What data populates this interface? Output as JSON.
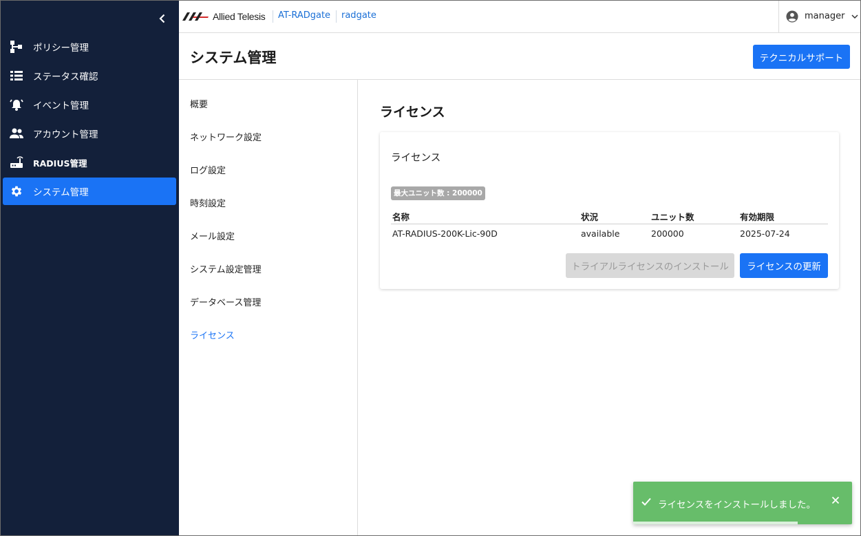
{
  "colors": {
    "sidebar_bg": "#13203a",
    "accent": "#1a73f5",
    "toast_bg": "#67bd6a"
  },
  "header": {
    "logo_text": "Allied Telesis",
    "breadcrumbs": [
      "AT-RADgate",
      "radgate"
    ],
    "user": "manager"
  },
  "sidebar": {
    "items": [
      {
        "label": "ポリシー管理",
        "icon": "policy-tree-icon"
      },
      {
        "label": "ステータス確認",
        "icon": "list-icon"
      },
      {
        "label": "イベント管理",
        "icon": "alarm-bell-icon"
      },
      {
        "label": "アカウント管理",
        "icon": "people-icon"
      },
      {
        "label": "RADIUS管理",
        "icon": "router-icon"
      },
      {
        "label": "システム管理",
        "icon": "gear-icon",
        "active": true
      }
    ]
  },
  "page": {
    "title": "システム管理",
    "tech_support_label": "テクニカルサポート"
  },
  "subnav": {
    "items": [
      "概要",
      "ネットワーク設定",
      "ログ設定",
      "時刻設定",
      "メール設定",
      "システム設定管理",
      "データベース管理",
      "ライセンス"
    ],
    "active_index": 7
  },
  "license": {
    "section_title": "ライセンス",
    "card_title": "ライセンス",
    "max_units_chip": "最大ユニット数 : 200000",
    "columns": [
      "名称",
      "状況",
      "ユニット数",
      "有効期限"
    ],
    "rows": [
      [
        "AT-RADIUS-200K-Lic-90D",
        "available",
        "200000",
        "2025-07-24"
      ]
    ],
    "trial_button": "トライアルライセンスのインストール",
    "update_button": "ライセンスの更新"
  },
  "toast": {
    "message": "ライセンスをインストールしました。",
    "progress": 0.75
  }
}
